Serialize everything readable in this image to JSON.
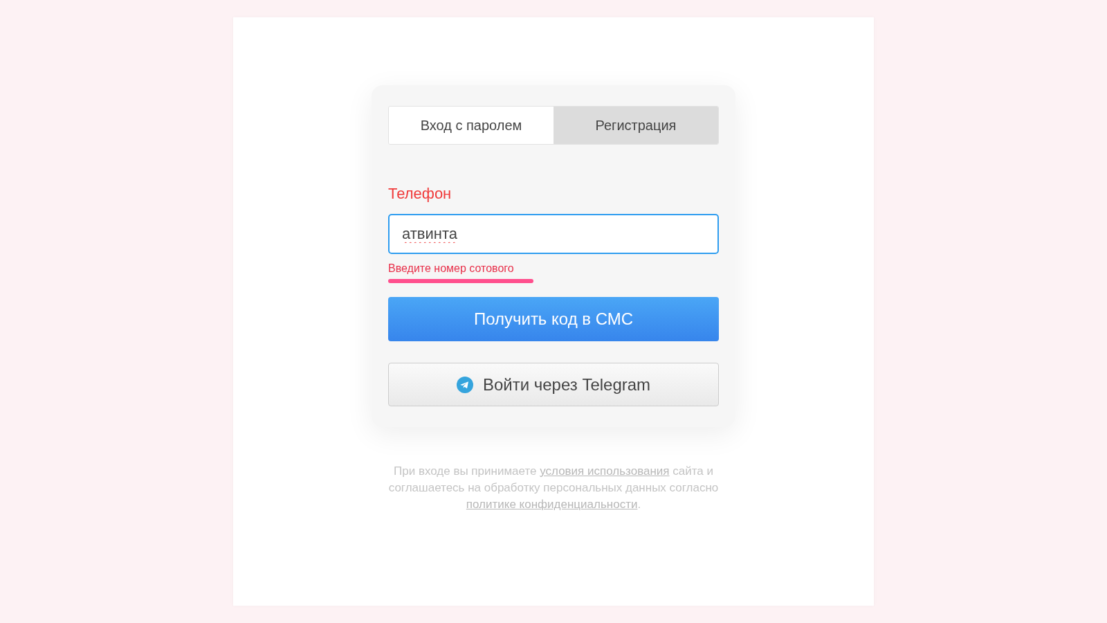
{
  "tabs": [
    {
      "label": "Вход с паролем",
      "selected": true
    },
    {
      "label": "Регистрация",
      "selected": false
    }
  ],
  "phone_field": {
    "label": "Телефон",
    "value": "атвинта",
    "invalid": true,
    "misspelled": true,
    "error": "Введите номер сотового",
    "error_highlighted": true
  },
  "sms_button": {
    "label": "Получить код в СМС"
  },
  "telegram_button": {
    "label": "Войти через Telegram"
  },
  "legal": {
    "parts": [
      {
        "kind": "text",
        "text": "При входе вы принимаете "
      },
      {
        "kind": "link",
        "text": "условия использования"
      },
      {
        "kind": "text",
        "text": " сайта и соглашаетесь на обработку персональных данных согласно "
      },
      {
        "kind": "link",
        "text": "политике конфиденциальности"
      },
      {
        "kind": "text",
        "text": "."
      }
    ]
  }
}
